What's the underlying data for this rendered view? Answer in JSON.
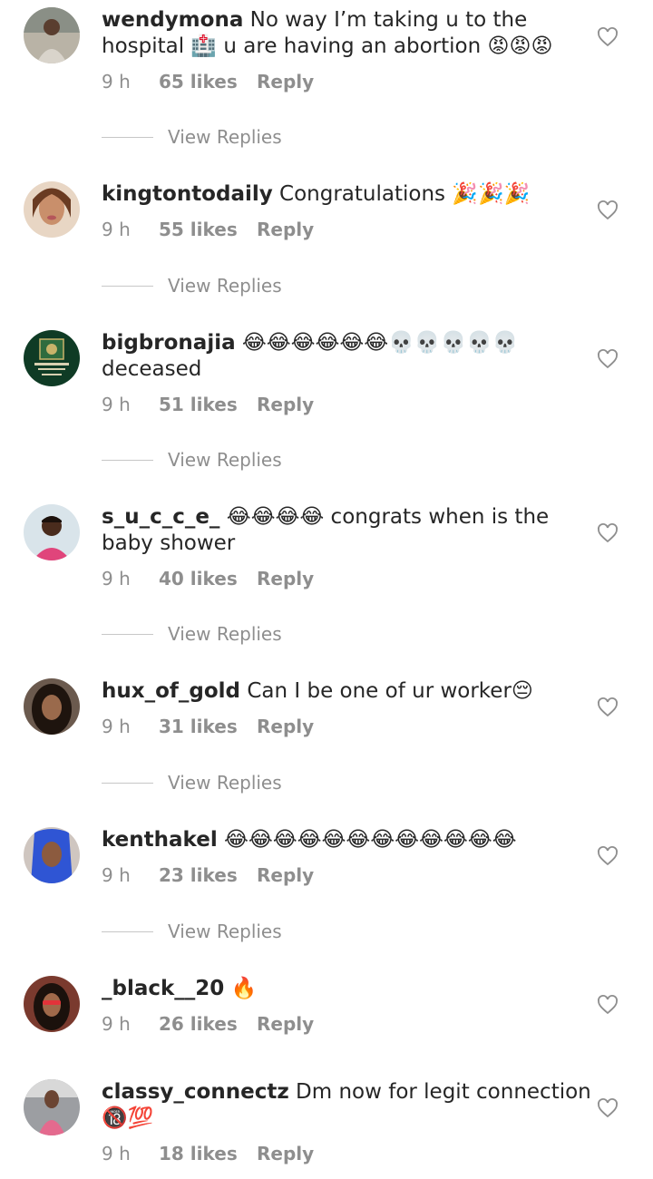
{
  "comments": [
    {
      "username": "wendymona",
      "text": "No way I’m taking u to the hospital 🏥 u are having an abortion 😡😡😡",
      "time": "9 h",
      "likes": "65 likes",
      "reply": "Reply",
      "view_replies": "View Replies"
    },
    {
      "username": "kingtontodaily",
      "text": "Congratulations 🎉🎉🎉",
      "time": "9 h",
      "likes": "55 likes",
      "reply": "Reply",
      "view_replies": "View Replies"
    },
    {
      "username": "bigbronajia",
      "text": "😂😂😂😂😂😂💀💀💀💀💀 deceased",
      "time": "9 h",
      "likes": "51 likes",
      "reply": "Reply",
      "view_replies": "View Replies"
    },
    {
      "username": "s_u_c_c_e_",
      "text": "😂😂😂😂 congrats when is the baby shower",
      "time": "9 h",
      "likes": "40 likes",
      "reply": "Reply",
      "view_replies": "View Replies"
    },
    {
      "username": "hux_of_gold",
      "text": "Can I be one of ur worker😔",
      "time": "9 h",
      "likes": "31 likes",
      "reply": "Reply",
      "view_replies": "View Replies"
    },
    {
      "username": "kenthakel",
      "text": "😂😂😂😂😂😂😂😂😂😂😂😂",
      "time": "9 h",
      "likes": "23 likes",
      "reply": "Reply",
      "view_replies": "View Replies"
    },
    {
      "username": "_black__20",
      "text": "🔥",
      "time": "9 h",
      "likes": "26 likes",
      "reply": "Reply"
    },
    {
      "username": "classy_connectz",
      "text": "Dm now for legit connection 🔞💯",
      "time": "9 h",
      "likes": "18 likes",
      "reply": "Reply"
    }
  ],
  "colors": {
    "text": "#262626",
    "meta": "#8e8e8e",
    "heart": "#8e8e8e",
    "divider": "#c7c7c7"
  },
  "icons": {
    "heart": "heart-outline-icon"
  }
}
